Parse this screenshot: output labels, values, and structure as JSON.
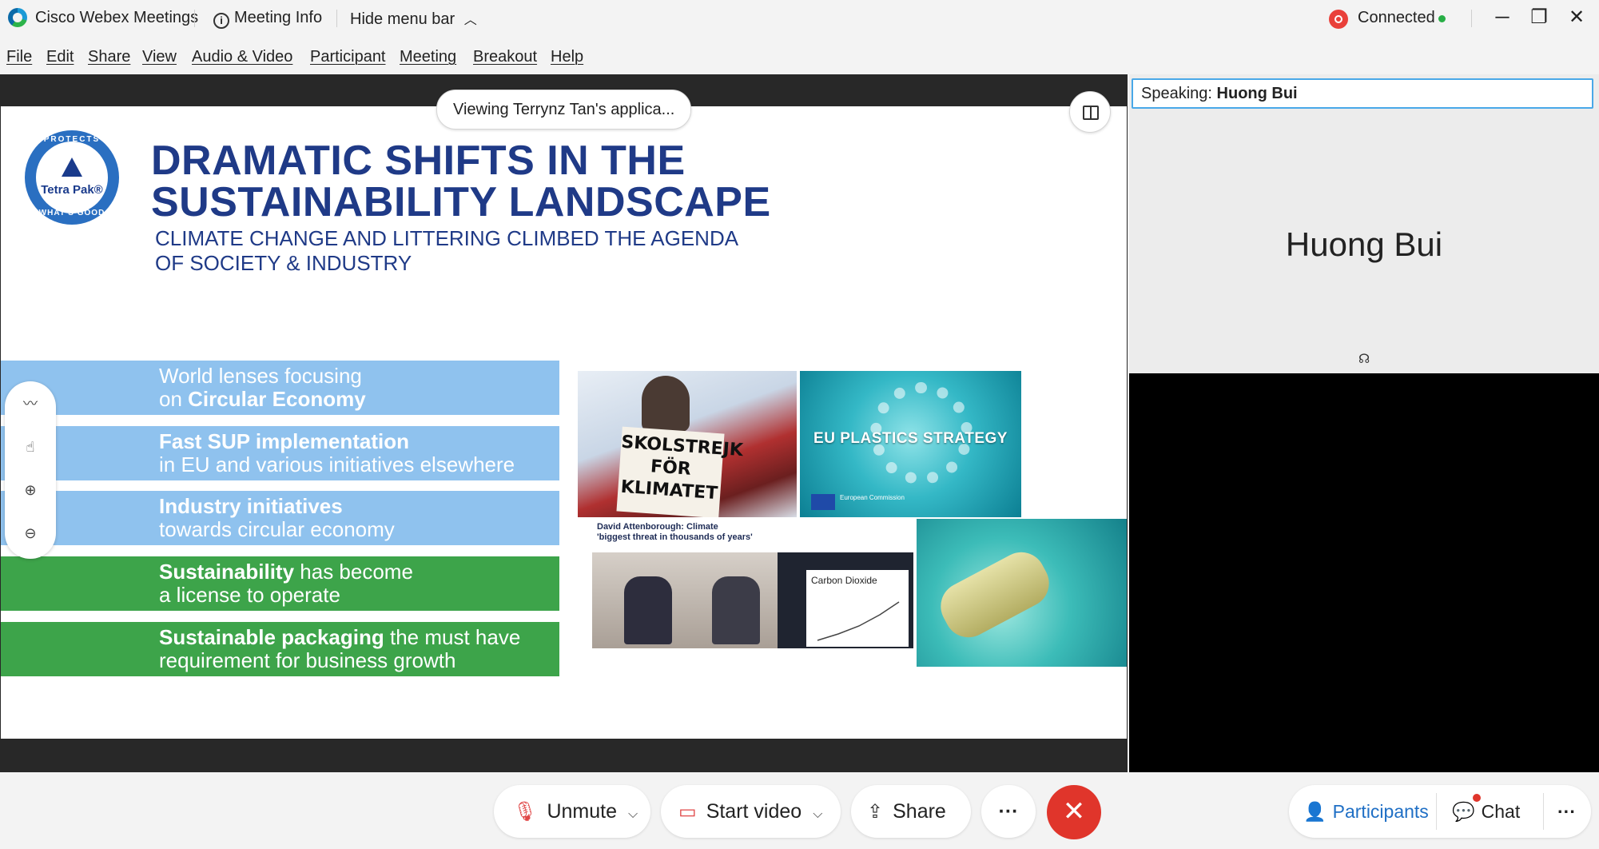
{
  "titlebar": {
    "app_name": "Cisco Webex Meetings",
    "meeting_info": "Meeting Info",
    "hide_menu": "Hide menu bar",
    "status": "Connected",
    "minimize": "─",
    "restore": "❐",
    "close": "✕"
  },
  "menu": {
    "file": "File",
    "edit": "Edit",
    "share": "Share",
    "view": "View",
    "audio_video": "Audio & Video",
    "participant": "Participant",
    "meeting": "Meeting",
    "breakout": "Breakout",
    "help": "Help"
  },
  "share": {
    "viewing": "Viewing Terrynz Tan's applica..."
  },
  "slide": {
    "logo_top": "PROTECTS",
    "logo_name": "Tetra Pak®",
    "logo_bottom": "WHAT'S GOOD",
    "title_line1": "DRAMATIC SHIFTS IN THE",
    "title_line2": "SUSTAINABILITY LANDSCAPE",
    "subtitle_line1": "CLIMATE CHANGE AND LITTERING CLIMBED THE AGENDA",
    "subtitle_line2": "OF SOCIETY & INDUSTRY",
    "bands": [
      {
        "l1_pre": "World lenses focusing",
        "l2_pre": "on ",
        "l2_bold": "Circular Economy"
      },
      {
        "l1_bold": "Fast SUP implementation",
        "l2": "in EU and various initiatives elsewhere"
      },
      {
        "l1_bold": "Industry initiatives",
        "l2": "towards circular economy"
      },
      {
        "l1_bold": "Sustainability",
        "l1_rest": " has become",
        "l2": "a license to operate"
      },
      {
        "l1_bold": "Sustainable packaging",
        "l1_rest": " the must have",
        "l2": "requirement for business growth"
      }
    ],
    "img_sign": "SKOLSTREJK FÖR KLIMATET",
    "img_eu": "EU PLASTICS STRATEGY",
    "img_eu_small": "European Commission",
    "img_caption_l1": "David Attenborough: Climate",
    "img_caption_l2": "'biggest threat in thousands of years'",
    "img_chart_title": "Carbon Dioxide"
  },
  "video": {
    "speaking_label": "Speaking:",
    "speaking_name": "Huong Bui",
    "participant_name": "Huong Bui"
  },
  "controls": {
    "unmute": "Unmute",
    "start_video": "Start video",
    "share": "Share",
    "more": "···",
    "end": "✕",
    "participants": "Participants",
    "chat": "Chat",
    "more_right": "···"
  },
  "colors": {
    "accent_blue": "#1f6fc5",
    "end_red": "#e0352b",
    "slide_navy": "#1f3a87",
    "band_blue": "#8fc2ee",
    "band_green": "#3da44a"
  }
}
